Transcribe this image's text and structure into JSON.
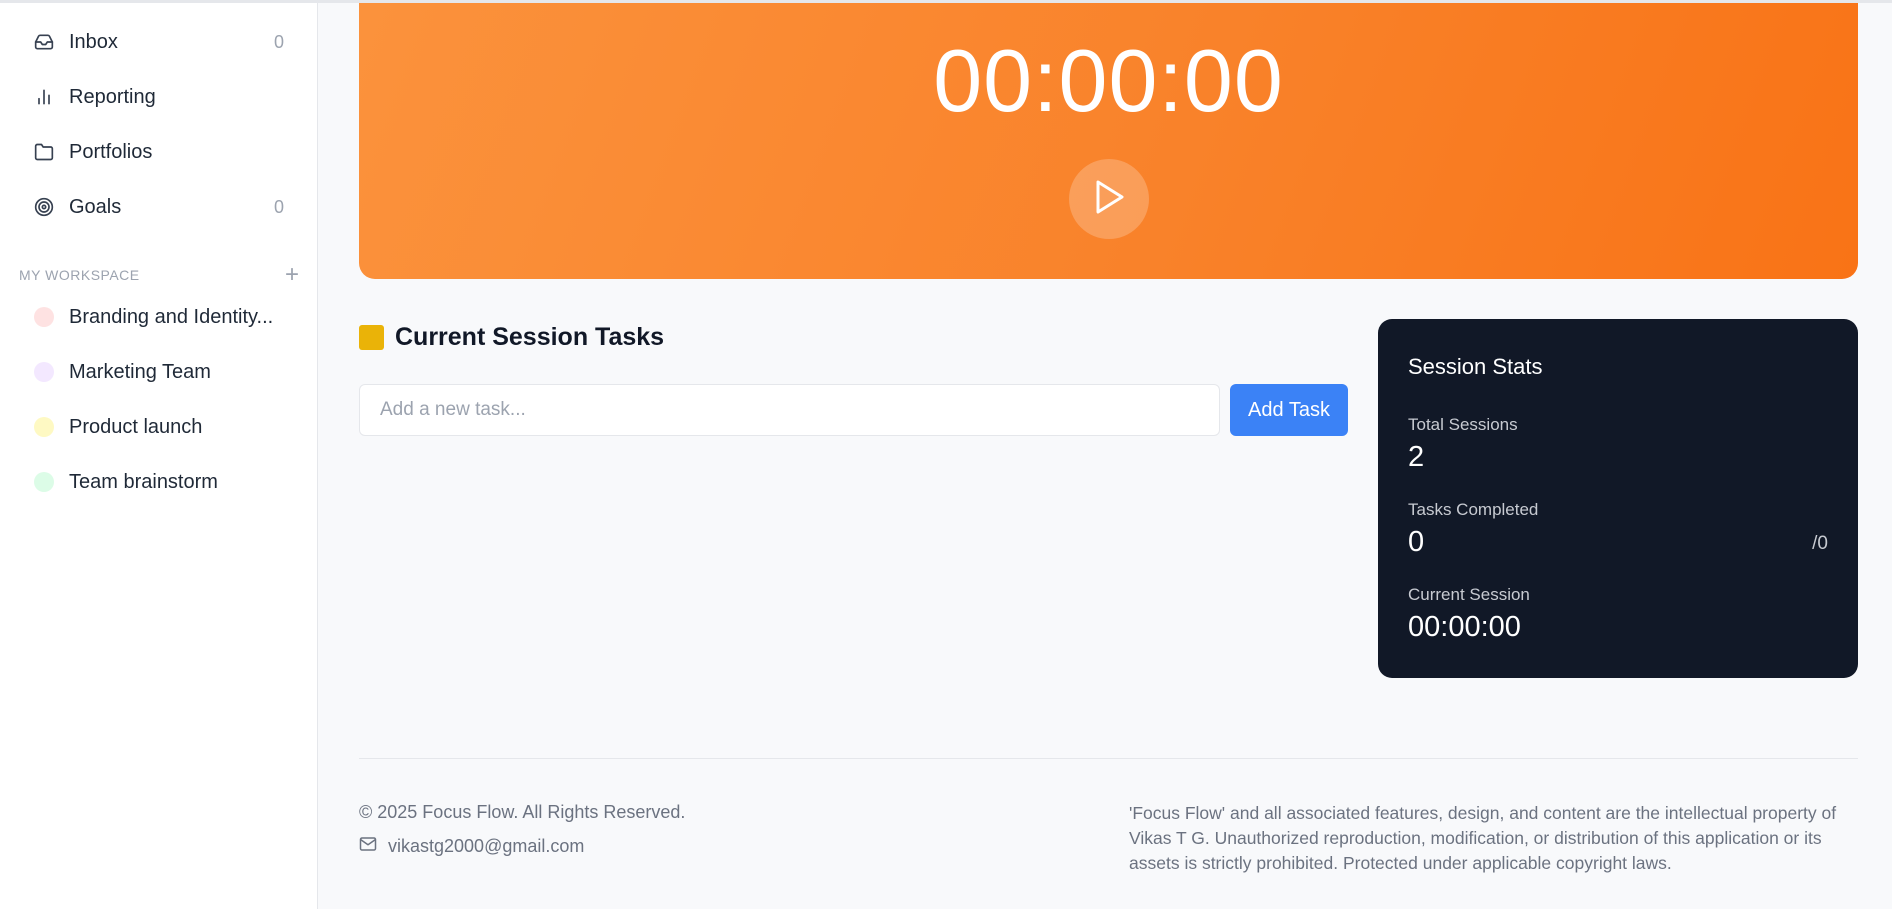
{
  "sidebar": {
    "nav": [
      {
        "label": "Inbox",
        "icon": "inbox-icon",
        "count": "0"
      },
      {
        "label": "Reporting",
        "icon": "bar-chart-icon",
        "count": ""
      },
      {
        "label": "Portfolios",
        "icon": "folder-icon",
        "count": ""
      },
      {
        "label": "Goals",
        "icon": "target-icon",
        "count": "0"
      }
    ],
    "workspace_title": "MY WORKSPACE",
    "workspace_add": "+",
    "projects": [
      {
        "label": "Branding and Identity...",
        "color": "#fee2e2"
      },
      {
        "label": "Marketing Team",
        "color": "#f3e8ff"
      },
      {
        "label": "Product launch",
        "color": "#fef9c3"
      },
      {
        "label": "Team brainstorm",
        "color": "#dcfce7"
      }
    ]
  },
  "timer": {
    "display": "00:00:00",
    "gradient_from": "#fb923c",
    "gradient_to": "#f97316",
    "play_icon": "play-icon"
  },
  "tasks": {
    "title": "Current Session Tasks",
    "accent": "#eab308",
    "input_placeholder": "Add a new task...",
    "add_label": "Add Task",
    "button_color": "#3b82f6"
  },
  "stats": {
    "title": "Session Stats",
    "total_sessions_label": "Total Sessions",
    "total_sessions_value": "2",
    "tasks_completed_label": "Tasks Completed",
    "tasks_completed_value": "0",
    "tasks_completed_suffix": "/0",
    "current_session_label": "Current Session",
    "current_session_value": "00:00:00",
    "background": "#111827"
  },
  "footer": {
    "copyright": "© 2025 Focus Flow. All Rights Reserved.",
    "email": "vikastg2000@gmail.com",
    "email_icon": "mail-icon",
    "legal": "'Focus Flow' and all associated features, design, and content are the intellectual property of Vikas T G. Unauthorized reproduction, modification, or distribution of this application or its assets is strictly prohibited. Protected under applicable copyright laws."
  }
}
